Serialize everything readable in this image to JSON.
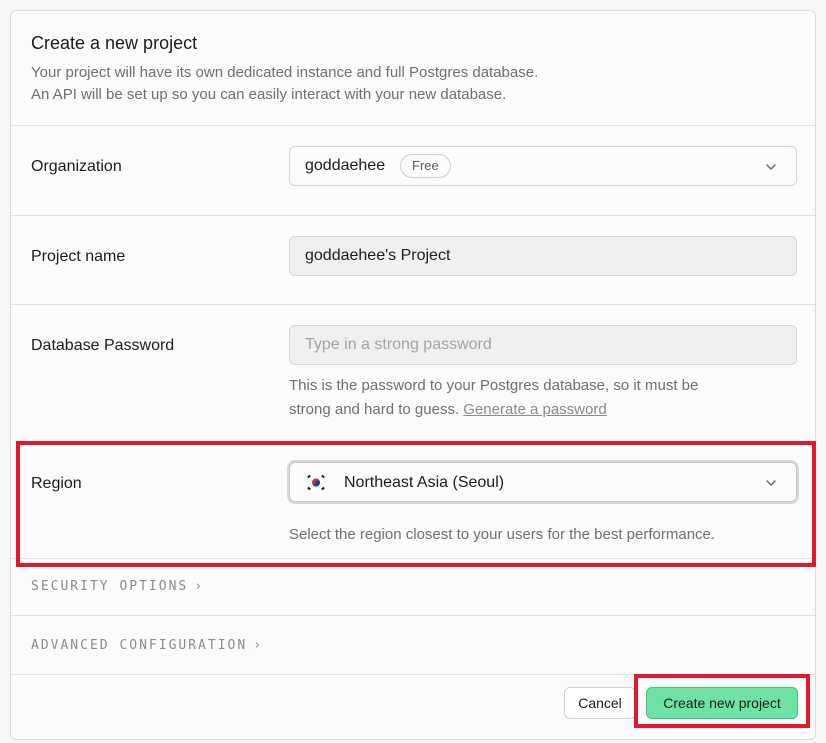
{
  "header": {
    "title": "Create a new project",
    "subtitle_line1": "Your project will have its own dedicated instance and full Postgres database.",
    "subtitle_line2": "An API will be set up so you can easily interact with your new database."
  },
  "organization": {
    "label": "Organization",
    "value": "goddaehee",
    "badge": "Free",
    "icon": "chevron-down-icon"
  },
  "project_name": {
    "label": "Project name",
    "value": "goddaehee's Project"
  },
  "database_password": {
    "label": "Database Password",
    "value": "",
    "placeholder": "Type in a strong password",
    "help_line1": "This is the password to your Postgres database, so it must be",
    "help_line2_prefix": "strong and hard to guess. ",
    "generate_link": "Generate a password"
  },
  "region": {
    "label": "Region",
    "value": "Northeast Asia (Seoul)",
    "flag_icon": "south-korea-flag-icon",
    "help": "Select the region closest to your users for the best performance."
  },
  "security_options": {
    "label": "SECURITY OPTIONS",
    "icon": "chevron-right-icon"
  },
  "advanced_configuration": {
    "label": "ADVANCED CONFIGURATION",
    "icon": "chevron-right-icon"
  },
  "footer": {
    "cancel_label": "Cancel",
    "create_label": "Create new project"
  },
  "colors": {
    "highlight": "#e0192b",
    "create_button": "#6fe3a3"
  }
}
